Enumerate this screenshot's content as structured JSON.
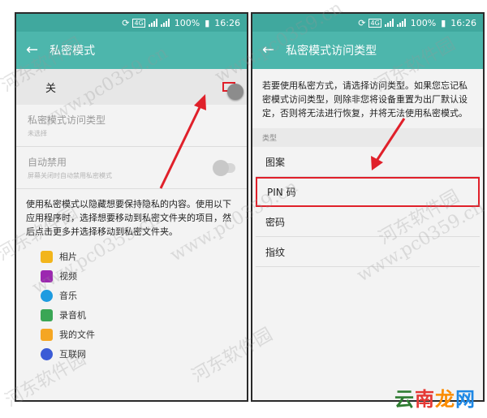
{
  "status_bar": {
    "battery": "100%",
    "time": "16:26",
    "network": "4G"
  },
  "left_screen": {
    "title": "私密模式",
    "toggle_label": "关",
    "settings": [
      {
        "title": "私密模式访问类型",
        "subtitle": "未选择"
      },
      {
        "title": "自动禁用",
        "subtitle": "屏幕关闭时自动禁用私密模式"
      }
    ],
    "description": "使用私密模式以隐藏想要保持隐私的内容。使用以下应用程序时，选择想要移动到私密文件夹的项目，然后点击更多并选择移动到私密文件夹。",
    "apps": [
      {
        "label": "相片",
        "icon": "gallery-icon",
        "color": "#f2b51b"
      },
      {
        "label": "视频",
        "icon": "video-icon",
        "color": "#9c27b0"
      },
      {
        "label": "音乐",
        "icon": "music-icon",
        "color": "#1e9be0"
      },
      {
        "label": "录音机",
        "icon": "recorder-icon",
        "color": "#3aa655"
      },
      {
        "label": "我的文件",
        "icon": "folder-icon",
        "color": "#f5a623"
      },
      {
        "label": "互联网",
        "icon": "internet-icon",
        "color": "#3b5bd6"
      }
    ]
  },
  "right_screen": {
    "title": "私密模式访问类型",
    "intro": "若要使用私密方式，请选择访问类型。如果您忘记私密模式访问类型，则除非您将设备重置为出厂默认设定，否则将无法进行恢复，并将无法使用私密模式。",
    "section_label": "类型",
    "types": [
      "图案",
      "PIN 码",
      "密码",
      "指纹"
    ]
  },
  "watermark_text": [
    "河东软件园",
    "www.pc0359.cn"
  ],
  "logo": {
    "chars": [
      "云",
      "南",
      "龙",
      "网"
    ],
    "colors": [
      "#2f7d32",
      "#e53935",
      "#fb8c00",
      "#1e88e5"
    ]
  },
  "highlight_color": "#e0202a"
}
